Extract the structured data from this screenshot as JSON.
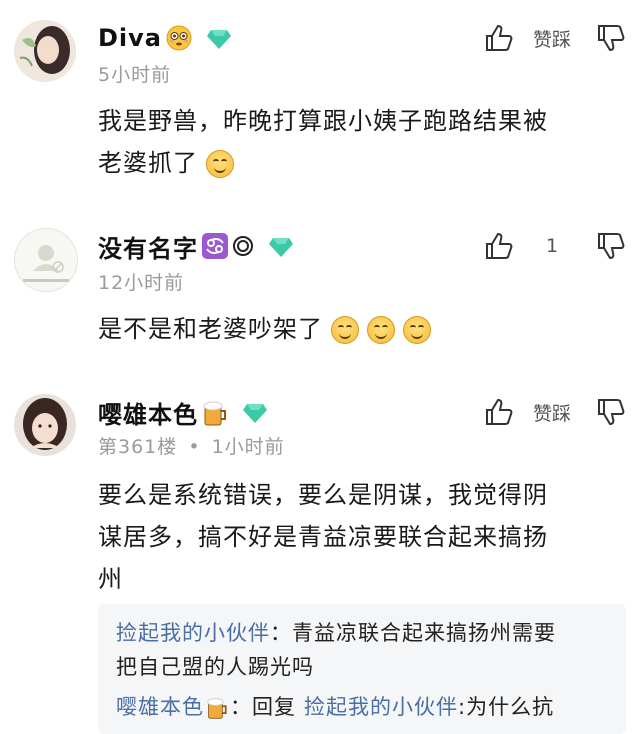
{
  "comments": [
    {
      "username": "Diva",
      "name_emoji": "flushed-face",
      "time": "5小时前",
      "text_line1": "我是野兽，昨晚打算跟小姨子跑路结果被",
      "text_line2": "老婆抓了",
      "like_label": "赞踩",
      "badge": "diamond-badge"
    },
    {
      "username": "没有名字",
      "name_emoji": "cancer-zodiac",
      "time": "12小时前",
      "text": "是不是和老婆吵架了",
      "like_count": "1",
      "badge": "diamond-badge"
    },
    {
      "username": "嘤雄本色",
      "name_emoji": "beer-mug",
      "floor": "第361楼",
      "dot": "•",
      "time": "1小时前",
      "text_line1": "要么是系统错误，要么是阴谋，我觉得阴",
      "text_line2": "谋居多，搞不好是青益凉要联合起来搞扬",
      "text_line3": "州",
      "like_label": "赞踩",
      "badge": "diamond-badge"
    }
  ],
  "replies": [
    {
      "author": "捡起我的小伙伴",
      "sep": "：",
      "text_line1": "青益凉联合起来搞扬州需要",
      "text_line2": "把自己盟的人踢光吗"
    },
    {
      "author": "嘤雄本色",
      "sep": "：",
      "reply_word": "回复",
      "target": "捡起我的小伙伴",
      "text": ":为什么抗"
    }
  ],
  "colors": {
    "link": "#4a6fa5",
    "meta": "#9a9a9a",
    "diamond": "#3cc9a8"
  }
}
